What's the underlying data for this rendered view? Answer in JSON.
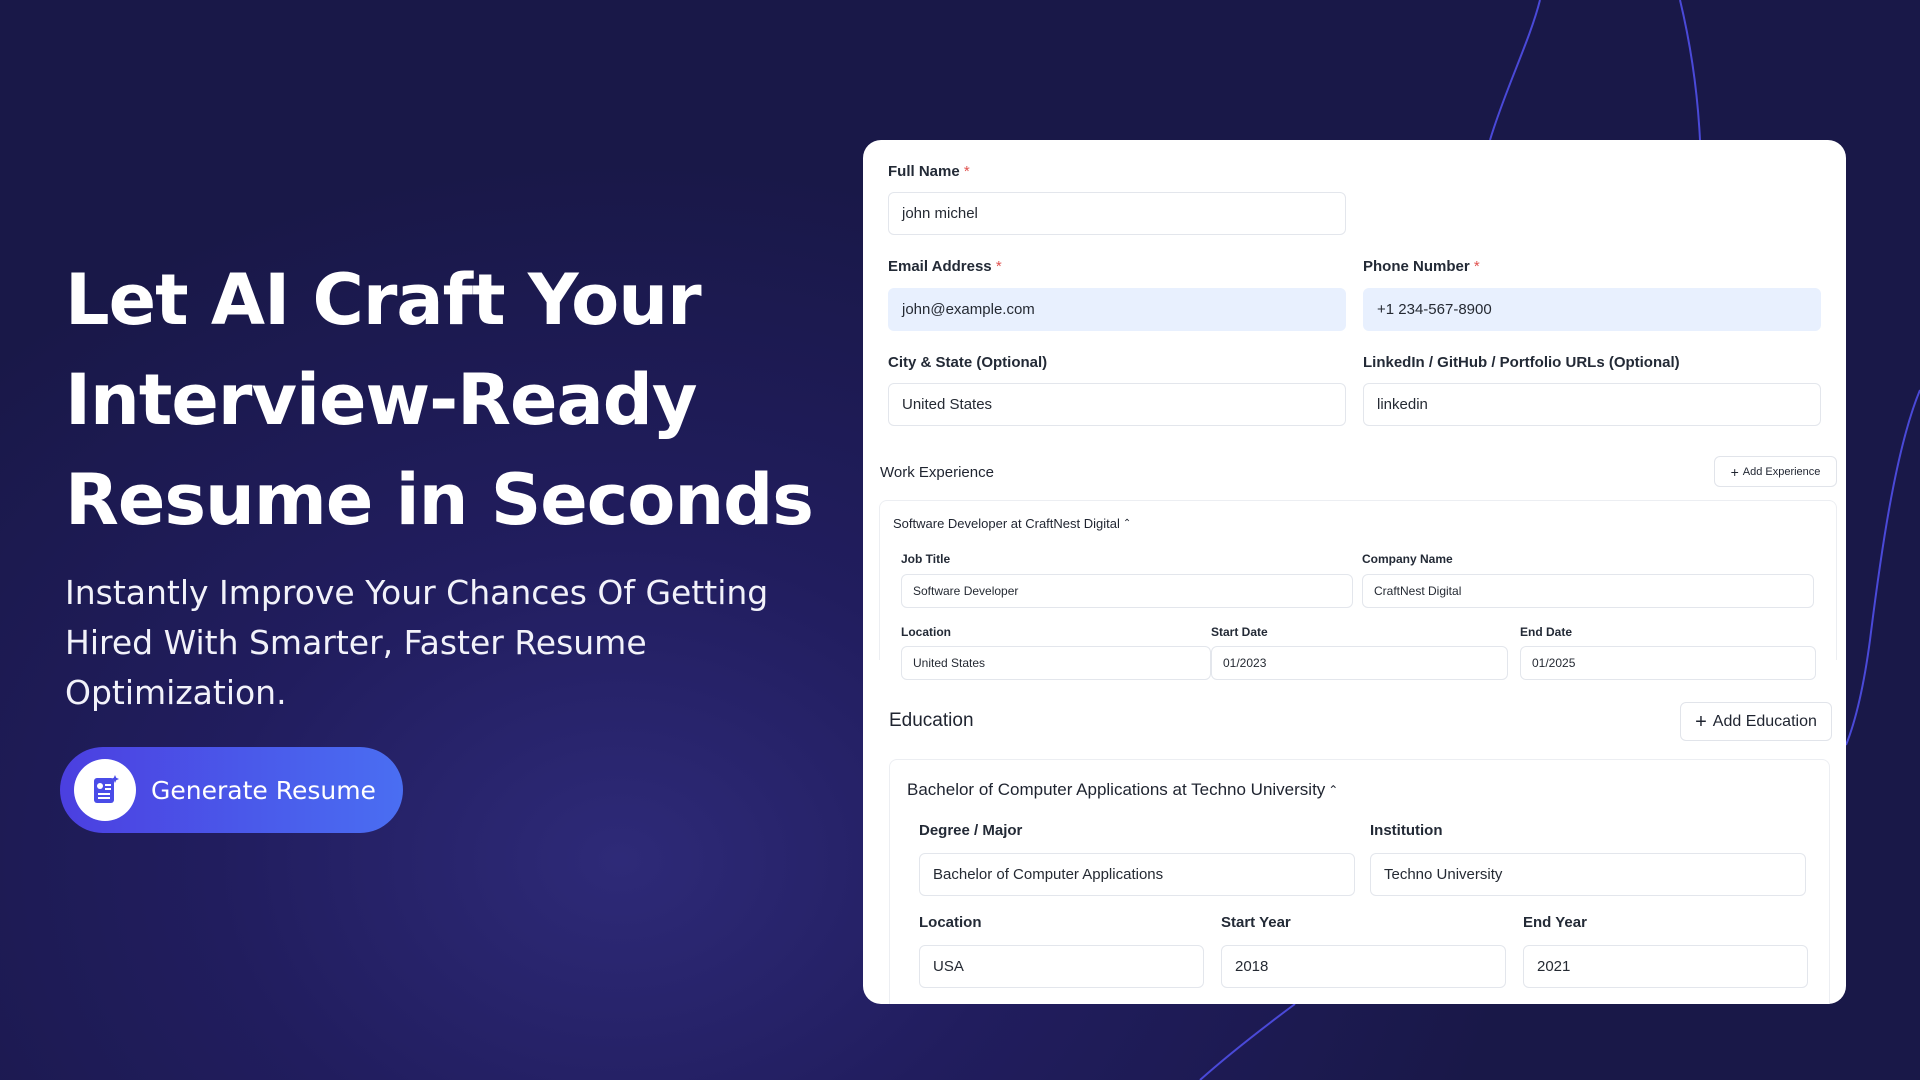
{
  "hero": {
    "title_line1": "Let AI Craft Your",
    "title_line2": "Interview-Ready",
    "title_line3": "Resume in Seconds",
    "subtitle_line1": "Instantly Improve Your Chances Of Getting",
    "subtitle_line2": "Hired With Smarter, Faster Resume",
    "subtitle_line3": "Optimization.",
    "cta_label": "Generate Resume",
    "cta_icon": "resume-document-icon"
  },
  "form": {
    "full_name": {
      "label": "Full Name",
      "required": "*",
      "value": "john michel"
    },
    "email": {
      "label": "Email Address",
      "required": "*",
      "value": "john@example.com"
    },
    "phone": {
      "label": "Phone Number",
      "required": "*",
      "value": "+1 234-567-8900"
    },
    "city": {
      "label": "City & State (Optional)",
      "value": "United States"
    },
    "links": {
      "label": "LinkedIn / GitHub / Portfolio URLs (Optional)",
      "value": "linkedin"
    },
    "work": {
      "title": "Work Experience",
      "add_label": "Add Experience",
      "entry": {
        "header": "Software Developer at CraftNest Digital",
        "job_title_label": "Job Title",
        "job_title": "Software Developer",
        "company_label": "Company Name",
        "company": "CraftNest Digital",
        "location_label": "Location",
        "location": "United States",
        "start_label": "Start Date",
        "start": "01/2023",
        "end_label": "End Date",
        "end": "01/2025"
      }
    },
    "education": {
      "title": "Education",
      "add_label": "Add Education",
      "entry": {
        "header": "Bachelor of Computer Applications at Techno University",
        "degree_label": "Degree / Major",
        "degree": "Bachelor of Computer Applications",
        "institution_label": "Institution",
        "institution": "Techno University",
        "location_label": "Location",
        "location": "USA",
        "start_label": "Start Year",
        "start": "2018",
        "end_label": "End Year",
        "end": "2021"
      }
    }
  },
  "colors": {
    "background": "#1e1b55",
    "accent": "#4b3fe0",
    "required": "#e0524f",
    "autofill": "#e8f0fe"
  }
}
